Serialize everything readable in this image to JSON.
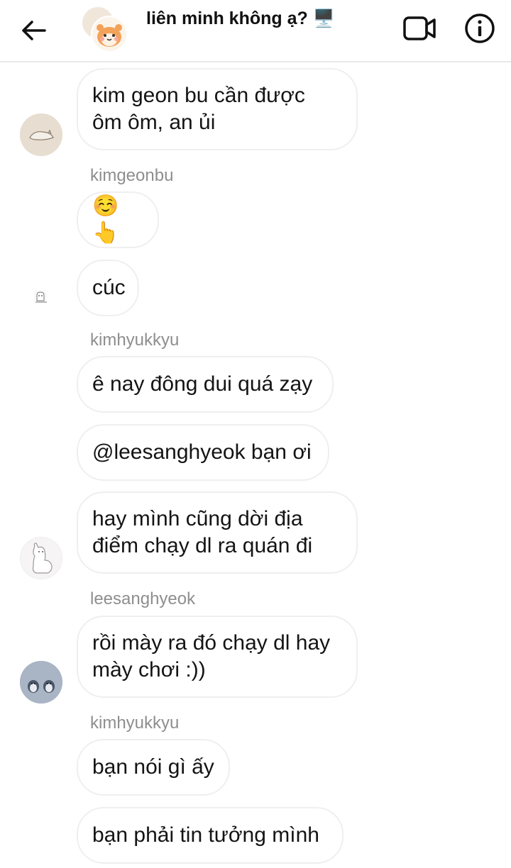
{
  "header": {
    "title": "liên minh không ạ? 🖥️",
    "icons": [
      "back-arrow-icon",
      "video-call-icon",
      "info-icon"
    ]
  },
  "messages": [
    {
      "text": "kim geon bu cần được ôm ôm, an ủi",
      "sender_avatar": "cat-sketch-avatar"
    },
    {
      "sender": "kimgeonbu",
      "text": "☺️👆"
    },
    {
      "text": "cúc",
      "sender_avatar": "small-dog-avatar"
    },
    {
      "sender": "kimhyukkyu",
      "text": "ê nay đông dui quá zạy"
    },
    {
      "text": "@leesanghyeok bạn ơi"
    },
    {
      "text": "hay mình cũng dời địa điểm chạy dl ra quán đi",
      "sender_avatar": "alpaca-avatar"
    },
    {
      "sender": "leesanghyeok",
      "text": "rồi mày ra đó chạy dl hay mày chơi :))",
      "sender_avatar": "penguins-avatar"
    },
    {
      "sender": "kimhyukkyu",
      "text": "bạn nói gì ấy"
    },
    {
      "text": "bạn phải tin tưởng mình"
    }
  ]
}
